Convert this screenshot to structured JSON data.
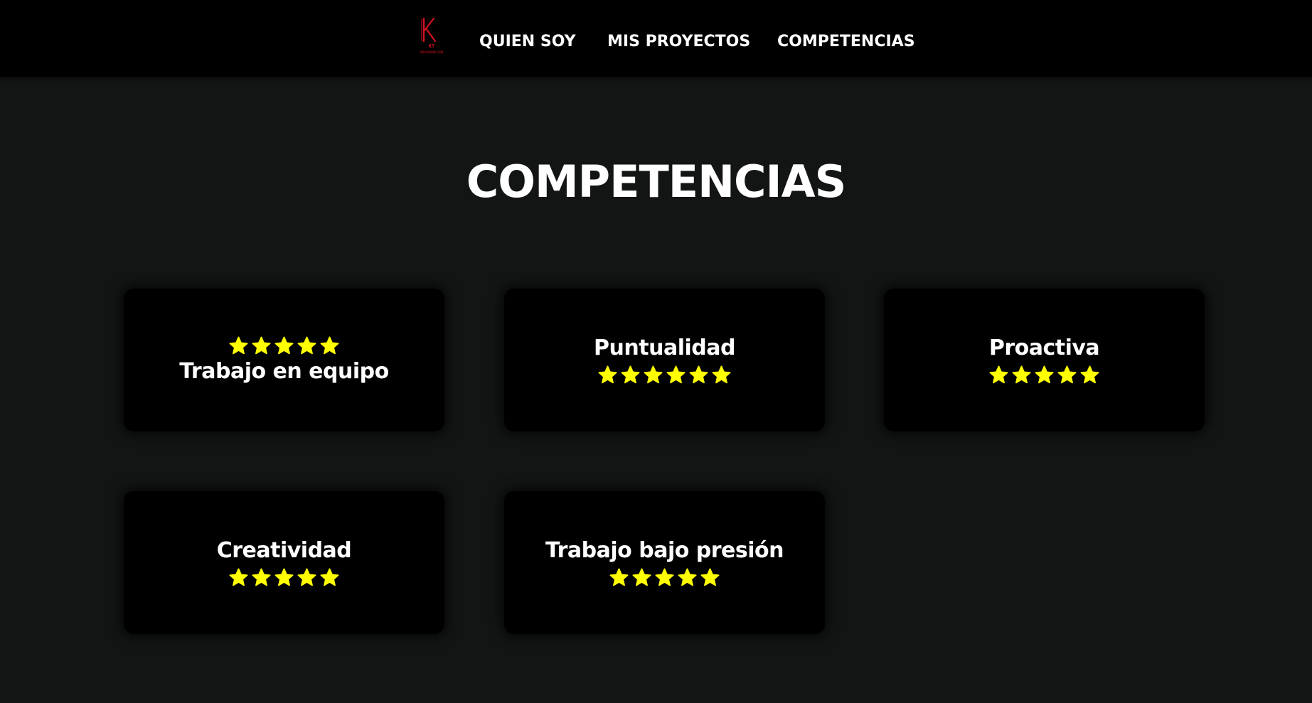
{
  "nav": {
    "logo": {
      "letter": "K",
      "text": "KT",
      "subtext": "PROGRAMACION",
      "color": "#d1121f"
    },
    "links": [
      {
        "label": "QUIEN SOY"
      },
      {
        "label": "MIS PROYECTOS"
      },
      {
        "label": "COMPETENCIAS"
      }
    ]
  },
  "section": {
    "title": "COMPETENCIAS"
  },
  "competencias": [
    {
      "label": "Trabajo en equipo",
      "stars": 5,
      "stars_position": "above"
    },
    {
      "label": "Puntualidad",
      "stars": 6,
      "stars_position": "below"
    },
    {
      "label": "Proactiva",
      "stars": 5,
      "stars_position": "below"
    },
    {
      "label": "Creatividad",
      "stars": 5,
      "stars_position": "below"
    },
    {
      "label": "Trabajo bajo presión",
      "stars": 5,
      "stars_position": "below"
    }
  ],
  "colors": {
    "background": "#131515",
    "navbar": "#000000",
    "card": "#000000",
    "text": "#ffffff",
    "star": "#ffff00",
    "brand": "#d1121f"
  },
  "icons": {
    "star": "star-icon",
    "logo": "kt-logo-icon"
  }
}
